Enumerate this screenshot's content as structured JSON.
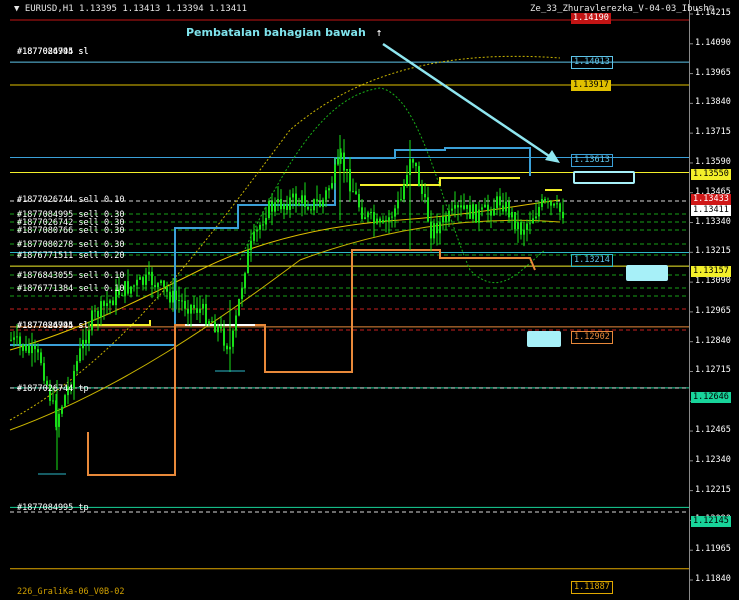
{
  "header": {
    "symbol_info": "EURUSD,H1  1.13395 1.13413 1.13394 1.13411",
    "indicator_name": "Ze_33_Zhuravlerezka_V-04-03_Ibush☺"
  },
  "annotation": {
    "text": "Pembatalan bahagian bawah",
    "mark": "↑"
  },
  "price_axis": {
    "ticks": [
      "1.14215",
      "1.14090",
      "1.13965",
      "1.13840",
      "1.13715",
      "1.13590",
      "1.13465",
      "1.13340",
      "1.13215",
      "1.13090",
      "1.12965",
      "1.12840",
      "1.12715",
      "1.12590",
      "1.12465",
      "1.12340",
      "1.12215",
      "1.12090",
      "1.11965",
      "1.11840"
    ],
    "current_price": "1.13411",
    "current_price_top": "1.13433"
  },
  "price_tags": [
    {
      "text": "1.14190",
      "color": "#c21414"
    },
    {
      "text": "1.14013",
      "color": "#5ec3e8"
    },
    {
      "text": "1.13917",
      "color": "#e0c000"
    },
    {
      "text": "1.13613",
      "color": "#3ba0d8"
    },
    {
      "text": "1.13550",
      "color": "#f3ef2a"
    },
    {
      "text": "1.13214",
      "color": "#2db8c8"
    },
    {
      "text": "1.13157",
      "color": "#f3ef2a"
    },
    {
      "text": "1.12902",
      "color": "#e8893a"
    },
    {
      "text": "1.12646",
      "color": "#18d49a"
    },
    {
      "text": "1.12145",
      "color": "#18d49a"
    },
    {
      "text": "1.11887",
      "color": "#e0a800"
    }
  ],
  "order_labels": [
    "#1877026744 sell 0.10",
    "#1877084995 sell 0.30",
    "#1877026742 sell 0.30",
    "#1877080766 sell 0.30",
    "#1877080278 sell 0.30",
    "#1876771511 sell 0.20",
    "#1876843055 sell 0.10",
    "#1876771384 sell 0.10",
    "#1877026744 tp",
    "#1877084995 tp"
  ],
  "overlapped_labels": [
    "#1877026744 sl",
    "#1877084995 sl"
  ],
  "footer_text": "226_GraliKa-06_V0B-02",
  "chart_data": {
    "type": "candlestick",
    "symbol": "EURUSD",
    "timeframe": "H1",
    "last": {
      "open": 1.13395,
      "high": 1.13413,
      "low": 1.13394,
      "close": 1.13411
    },
    "ylim": [
      1.1178,
      1.1425
    ],
    "horizontal_levels": [
      {
        "price": 1.1419,
        "color": "#c21414",
        "style": "solid"
      },
      {
        "price": 1.14013,
        "color": "#5ec3e8",
        "style": "solid"
      },
      {
        "price": 1.13917,
        "color": "#e0c000",
        "style": "solid"
      },
      {
        "price": 1.13613,
        "color": "#3ba0d8",
        "style": "solid"
      },
      {
        "price": 1.1355,
        "color": "#f3ef2a",
        "style": "solid"
      },
      {
        "price": 1.13214,
        "color": "#2db8c8",
        "style": "solid"
      },
      {
        "price": 1.13157,
        "color": "#f3ef2a",
        "style": "solid"
      },
      {
        "price": 1.12902,
        "color": "#e8893a",
        "style": "solid"
      },
      {
        "price": 1.12646,
        "color": "#18d49a",
        "style": "solid"
      },
      {
        "price": 1.12145,
        "color": "#18d49a",
        "style": "solid"
      },
      {
        "price": 1.11887,
        "color": "#e0a800",
        "style": "solid"
      }
    ]
  },
  "colors": {
    "candle": "#18e018",
    "upper_step": "#3ba0d8",
    "lower_step": "#e8893a",
    "yellow_step": "#f3ef2a",
    "envelope": "#c8b400",
    "envelope_dots": "#18c018",
    "arrow": "#8fe6f0"
  }
}
